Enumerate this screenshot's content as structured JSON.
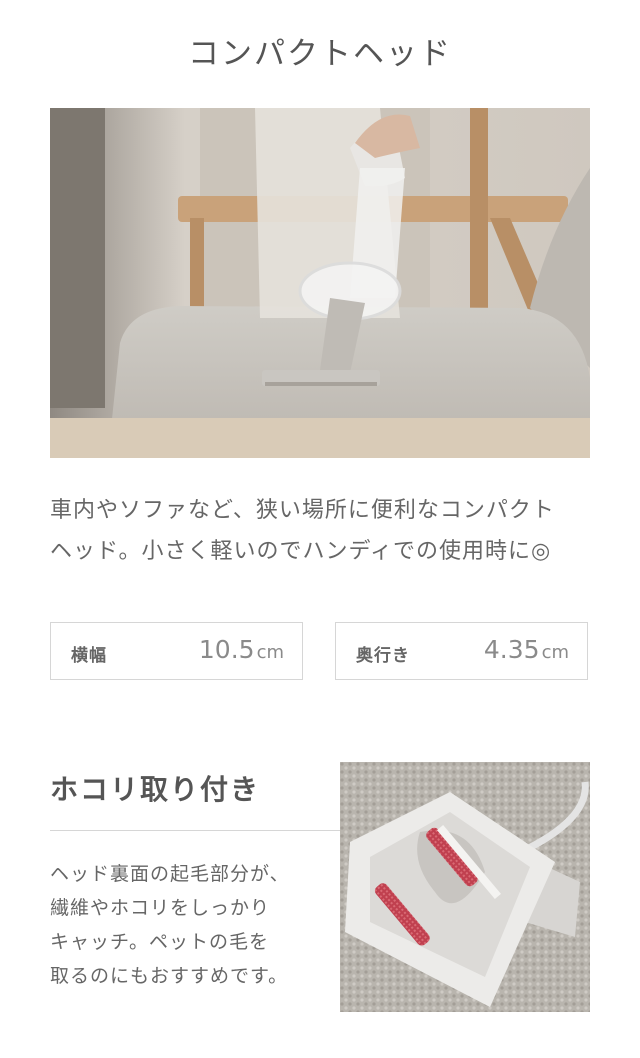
{
  "section_title": "コンパクトヘッド",
  "description": [
    "車内やソファなど、狭い場所に便利なコンパクト",
    "ヘッド。小さく軽いのでハンディでの使用時に◎"
  ],
  "specs": [
    {
      "label": "横幅",
      "value": "10.5",
      "unit": "cm"
    },
    {
      "label": "奥行き",
      "value": "4.35",
      "unit": "cm"
    }
  ],
  "feature": {
    "title": "ホコリ取り付き",
    "description": [
      "ヘッド裏面の起毛部分が、",
      "繊維やホコリをしっかり",
      "キャッチ。ペットの毛を",
      "取るのにもおすすめです。"
    ]
  },
  "colors": {
    "text": "#555555",
    "border": "#d6d6d6",
    "bristle": "#c0404f"
  }
}
